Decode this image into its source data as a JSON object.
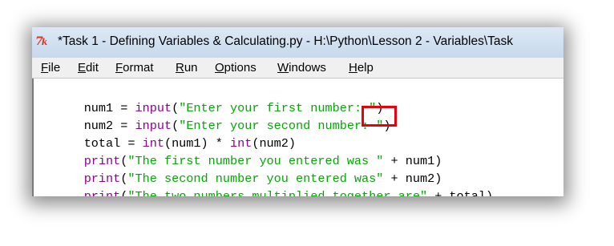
{
  "window": {
    "title": "*Task 1 - Defining Variables & Calculating.py - H:\\Python\\Lesson 2 - Variables\\Task"
  },
  "icons": {
    "app": "idle-python-icon"
  },
  "menu": [
    "File",
    "Edit",
    "Format",
    "Run",
    "Options",
    "Windows",
    "Help"
  ],
  "code": [
    [
      {
        "t": "num1 = ",
        "k": "plain"
      },
      {
        "t": "input",
        "k": "builtin"
      },
      {
        "t": "(",
        "k": "plain"
      },
      {
        "t": "\"Enter your first number: \"",
        "k": "str"
      },
      {
        "t": ")",
        "k": "plain"
      }
    ],
    [
      {
        "t": "num2 = ",
        "k": "plain"
      },
      {
        "t": "input",
        "k": "builtin"
      },
      {
        "t": "(",
        "k": "plain"
      },
      {
        "t": "\"Enter your second number: \"",
        "k": "str"
      },
      {
        "t": ")",
        "k": "plain"
      }
    ],
    [
      {
        "t": "total = ",
        "k": "plain"
      },
      {
        "t": "int",
        "k": "builtin"
      },
      {
        "t": "(num1) * ",
        "k": "plain"
      },
      {
        "t": "int",
        "k": "builtin"
      },
      {
        "t": "(num2)",
        "k": "plain"
      }
    ],
    [
      {
        "t": "print",
        "k": "builtin"
      },
      {
        "t": "(",
        "k": "plain"
      },
      {
        "t": "\"The first number you entered was \"",
        "k": "str"
      },
      {
        "t": " + num1)",
        "k": "plain"
      }
    ],
    [
      {
        "t": "print",
        "k": "builtin"
      },
      {
        "t": "(",
        "k": "plain"
      },
      {
        "t": "\"The second number you entered was\"",
        "k": "str"
      },
      {
        "t": " + num2)",
        "k": "plain"
      }
    ],
    [
      {
        "t": "print",
        "k": "builtin"
      },
      {
        "t": "(",
        "k": "plain"
      },
      {
        "t": "\"The two numbers multiplied together are\"",
        "k": "str"
      },
      {
        "t": " + total)",
        "k": "plain"
      }
    ]
  ],
  "colors": {
    "builtin": "#900090",
    "string": "#00aa00",
    "highlight_box": "#e8000b",
    "title_gradient_top": "#dde9f5"
  }
}
